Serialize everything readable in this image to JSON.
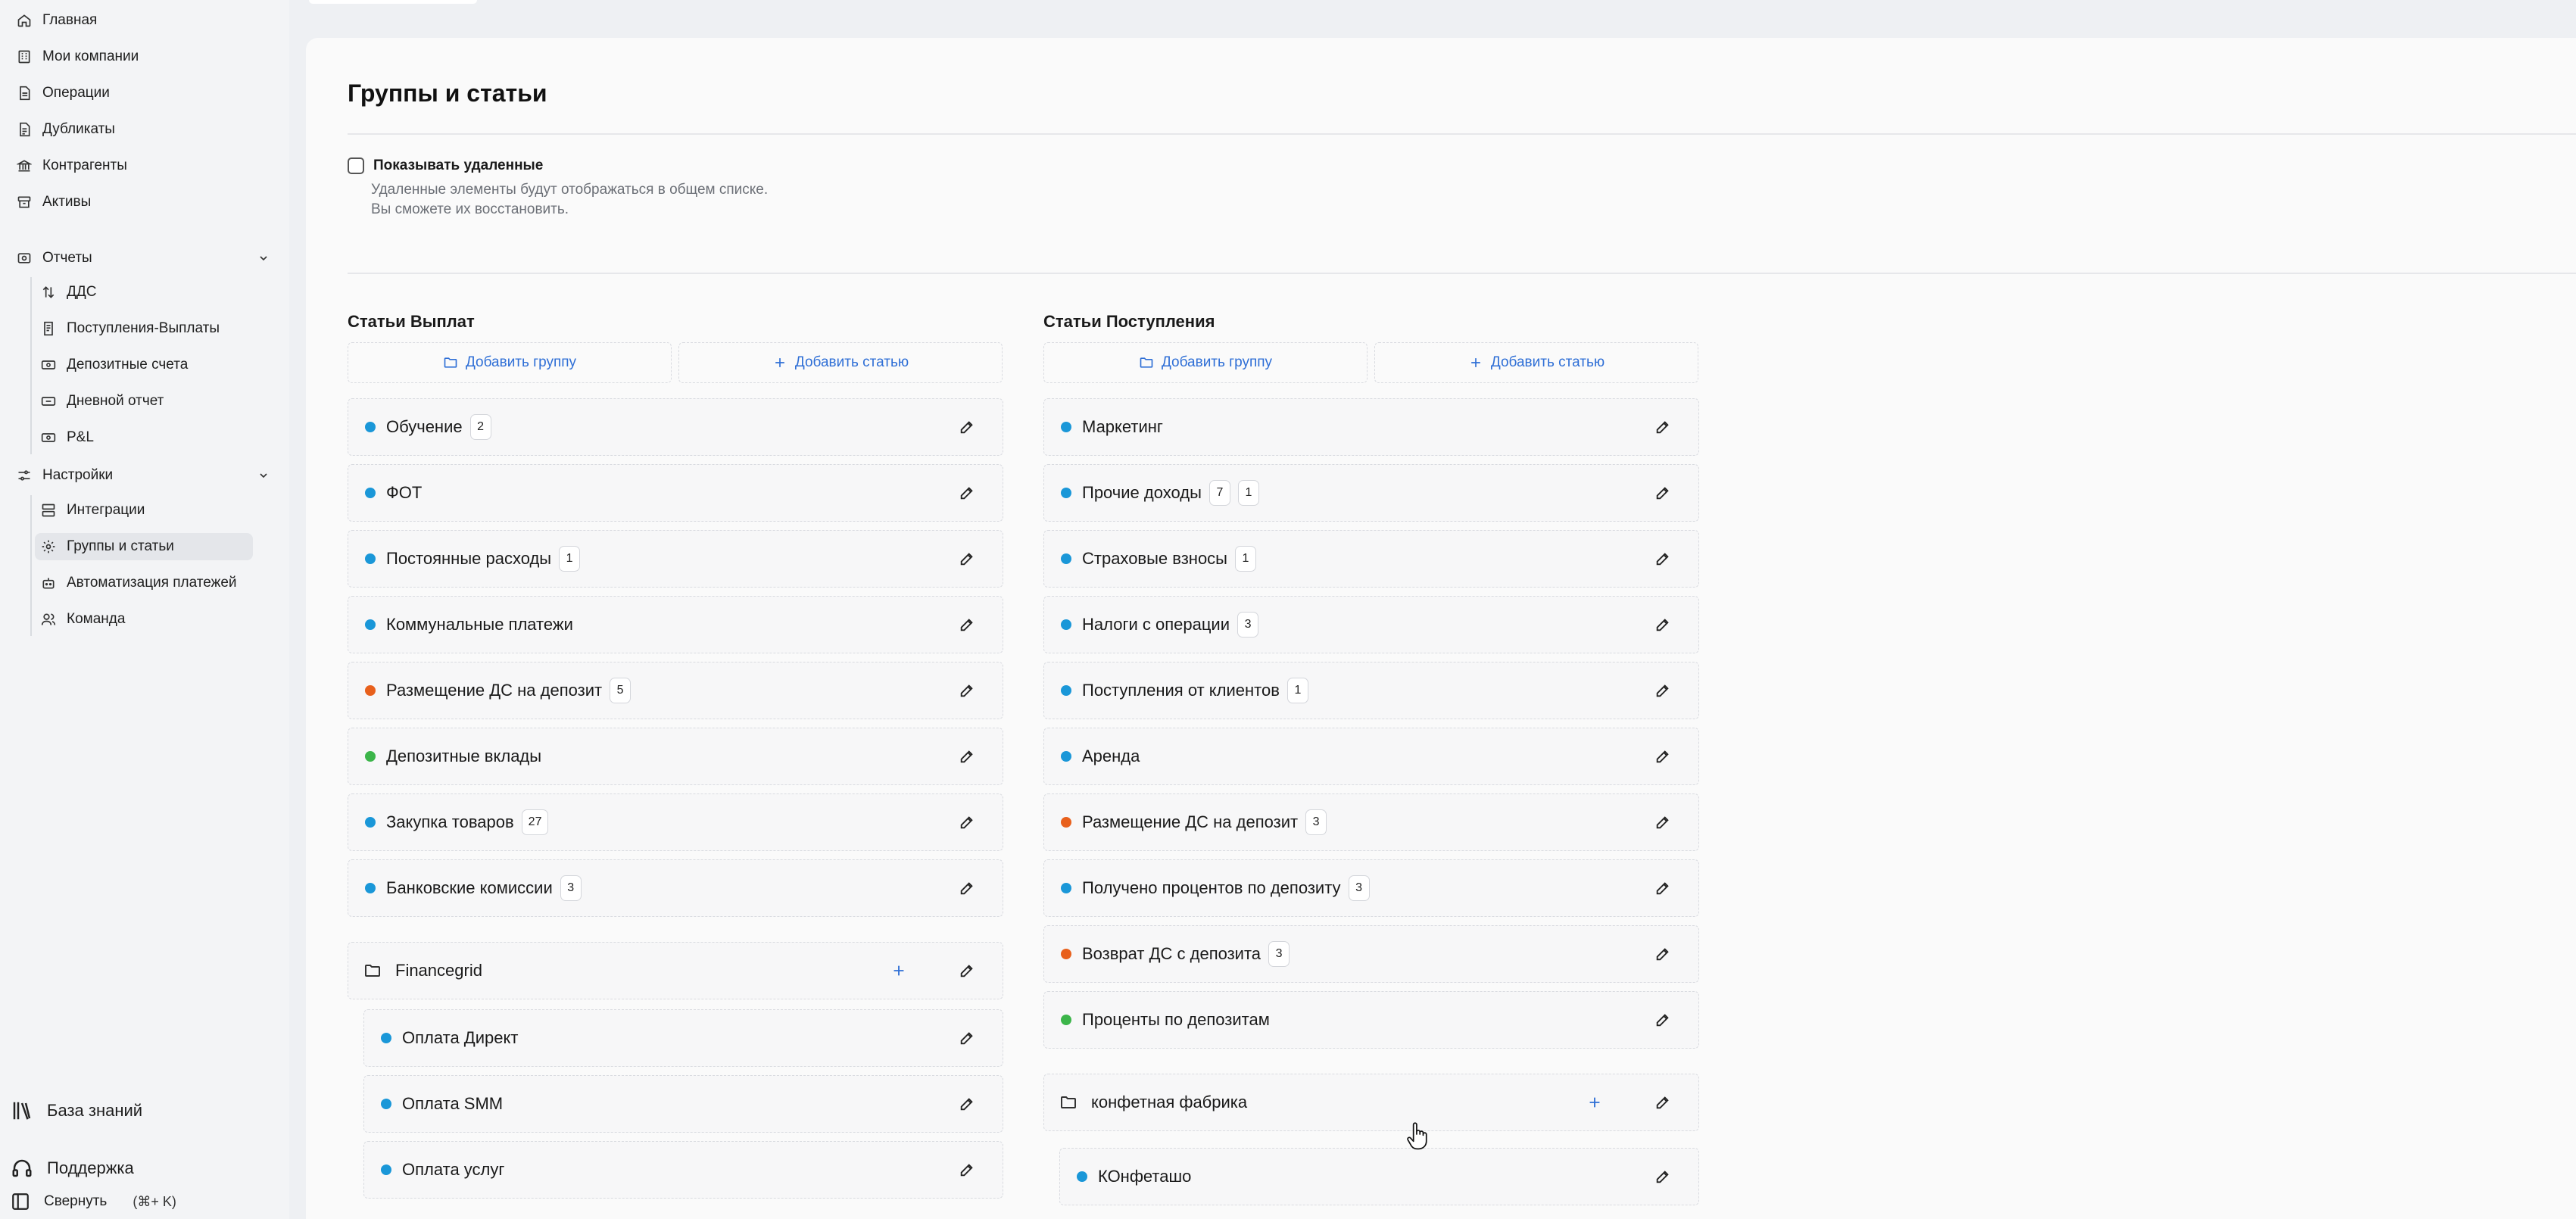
{
  "sidebar": {
    "items": [
      {
        "label": "Главная",
        "icon": "home-icon"
      },
      {
        "label": "Мои компании",
        "icon": "building-icon"
      },
      {
        "label": "Операции",
        "icon": "document-icon"
      },
      {
        "label": "Дубликаты",
        "icon": "copy-icon"
      },
      {
        "label": "Контрагенты",
        "icon": "bank-icon"
      },
      {
        "label": "Активы",
        "icon": "box-icon"
      }
    ],
    "reports": {
      "label": "Отчеты",
      "items": [
        {
          "label": "ДДС",
          "icon": "arrows-updown-icon"
        },
        {
          "label": "Поступления-Выплаты",
          "icon": "receipt-icon"
        },
        {
          "label": "Депозитные счета",
          "icon": "deposit-icon"
        },
        {
          "label": "Дневной отчет",
          "icon": "daily-report-icon"
        },
        {
          "label": "P&L",
          "icon": "pl-icon"
        }
      ]
    },
    "settings": {
      "label": "Настройки",
      "items": [
        {
          "label": "Интеграции",
          "icon": "server-icon"
        },
        {
          "label": "Группы и статьи",
          "icon": "gear-icon"
        },
        {
          "label": "Автоматизация платежей",
          "icon": "robot-icon"
        },
        {
          "label": "Команда",
          "icon": "users-icon"
        }
      ]
    },
    "bottom": {
      "knowledge": "База знаний",
      "support": "Поддержка",
      "collapse": "Свернуть",
      "collapse_shortcut": "(⌘+ K)"
    }
  },
  "page": {
    "title": "Группы и статьи",
    "show_deleted": {
      "label": "Показывать удаленные",
      "checked": false,
      "hint_line1": "Удаленные элементы будут отображаться в общем списке.",
      "hint_line2": "Вы сможете их восстановить."
    }
  },
  "colors": {
    "blue": "#1a97d8",
    "orange": "#e8601c",
    "green": "#3cb54a",
    "accent": "#2f6fd6"
  },
  "payouts": {
    "title": "Статьи Выплат",
    "add_group": "Добавить группу",
    "add_article": "Добавить статью",
    "articles": [
      {
        "label": "Обучение",
        "color": "blue",
        "badges": [
          "2"
        ]
      },
      {
        "label": "ФОТ",
        "color": "blue",
        "badges": []
      },
      {
        "label": "Постоянные расходы",
        "color": "blue",
        "badges": [
          "1"
        ]
      },
      {
        "label": "Коммунальные платежи",
        "color": "blue",
        "badges": []
      },
      {
        "label": "Размещение ДС на депозит",
        "color": "orange",
        "badges": [
          "5"
        ]
      },
      {
        "label": "Депозитные вклады",
        "color": "green",
        "badges": []
      },
      {
        "label": "Закупка товаров",
        "color": "blue",
        "badges": [
          "27"
        ]
      },
      {
        "label": "Банковские комиссии",
        "color": "blue",
        "badges": [
          "3"
        ]
      }
    ],
    "group": {
      "label": "Financegrid",
      "items": [
        {
          "label": "Оплата Директ",
          "color": "blue"
        },
        {
          "label": "Оплата SMM",
          "color": "blue"
        },
        {
          "label": "Оплата услуг",
          "color": "blue"
        }
      ]
    }
  },
  "receipts": {
    "title": "Статьи Поступления",
    "add_group": "Добавить группу",
    "add_article": "Добавить статью",
    "articles": [
      {
        "label": "Маркетинг",
        "color": "blue",
        "badges": []
      },
      {
        "label": "Прочие доходы",
        "color": "blue",
        "badges": [
          "7",
          "1"
        ]
      },
      {
        "label": "Страховые взносы",
        "color": "blue",
        "badges": [
          "1"
        ]
      },
      {
        "label": "Налоги с операции",
        "color": "blue",
        "badges": [
          "3"
        ]
      },
      {
        "label": "Поступления от клиентов",
        "color": "blue",
        "badges": [
          "1"
        ]
      },
      {
        "label": "Аренда",
        "color": "blue",
        "badges": []
      },
      {
        "label": "Размещение ДС на депозит",
        "color": "orange",
        "badges": [
          "3"
        ]
      },
      {
        "label": "Получено процентов по депозиту",
        "color": "blue",
        "badges": [
          "3"
        ]
      },
      {
        "label": "Возврат ДС с депозита",
        "color": "orange",
        "badges": [
          "3"
        ]
      },
      {
        "label": "Проценты по депозитам",
        "color": "green",
        "badges": []
      }
    ],
    "group": {
      "label": "конфетная фабрика",
      "items": [
        {
          "label": "КОнфеташо",
          "color": "blue"
        }
      ]
    }
  }
}
